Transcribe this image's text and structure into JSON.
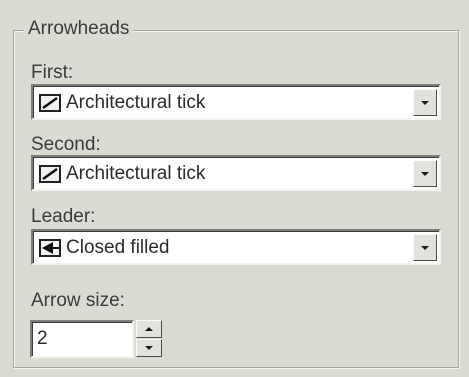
{
  "arrowheads": {
    "title": "Arrowheads",
    "first": {
      "label": "First:",
      "value": "Architectural tick",
      "icon": "architectural-tick-icon"
    },
    "second": {
      "label": "Second:",
      "value": "Architectural tick",
      "icon": "architectural-tick-icon"
    },
    "leader": {
      "label": "Leader:",
      "value": "Closed filled",
      "icon": "closed-filled-arrow-icon"
    },
    "arrow_size": {
      "label": "Arrow size:",
      "value": "2"
    }
  }
}
